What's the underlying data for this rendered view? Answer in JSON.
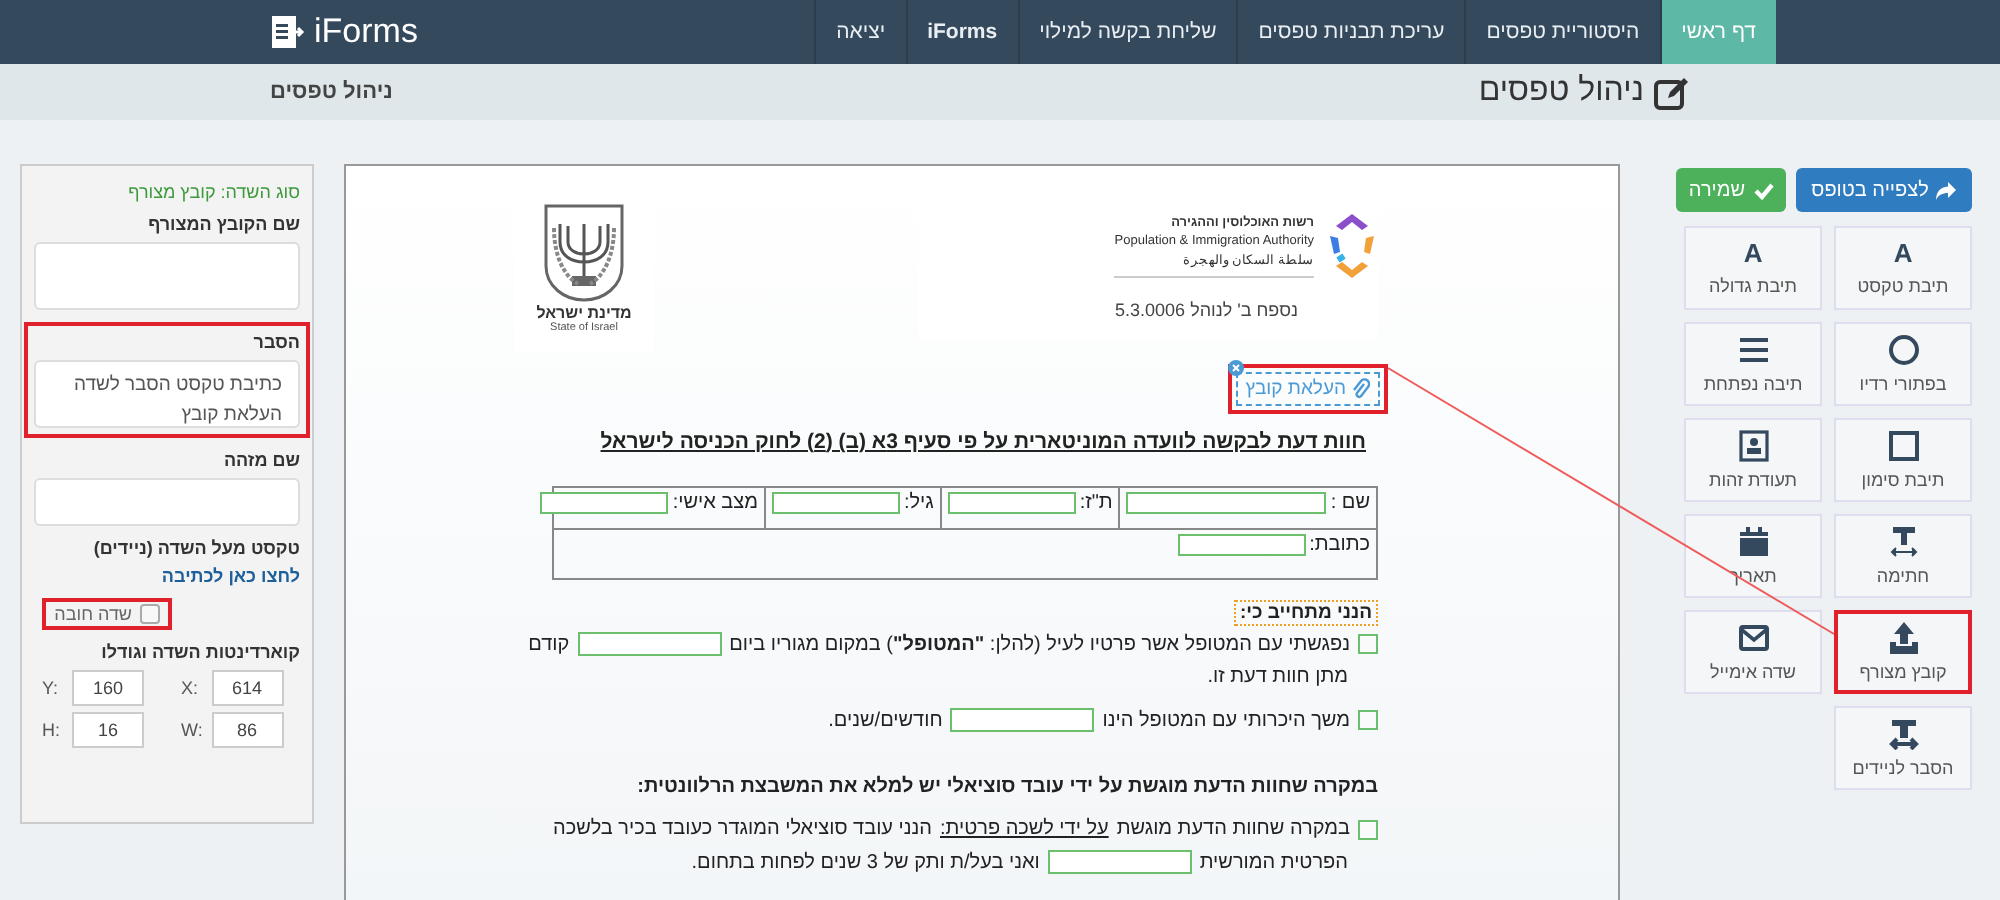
{
  "app": {
    "logo": "iForms"
  },
  "nav": [
    {
      "label": "דף ראשי",
      "selected": true,
      "bold": false
    },
    {
      "label": "היסטוריית טפסים",
      "selected": false,
      "bold": false
    },
    {
      "label": "עריכת תבניות טפסים",
      "selected": false,
      "bold": false
    },
    {
      "label": "שליחת בקשה למילוי",
      "selected": false,
      "bold": false
    },
    {
      "label": "iForms",
      "selected": false,
      "bold": true
    },
    {
      "label": "יציאה",
      "selected": false,
      "bold": false
    }
  ],
  "subheader": {
    "breadcrumb": "ניהול טפסים",
    "page_title": "ניהול טפסים"
  },
  "properties": {
    "field_type": "סוג השדה: קובץ מצורף",
    "sections": [
      {
        "kind": "textarea",
        "label": "שם הקובץ המצורף",
        "highlighted": false
      },
      {
        "kind": "textarea",
        "label": "הסבר",
        "value": "כתיבת טקסט הסבר לשדה העלאת קובץ",
        "highlighted": true
      },
      {
        "kind": "input",
        "label": "שם מזהה",
        "highlighted": false
      },
      {
        "kind": "link",
        "label": "טקסט מעל השדה (ניידים)",
        "link": "לחצו כאן לכתיבה",
        "highlighted": false
      },
      {
        "kind": "checkbox",
        "label": "שדה חובה",
        "checked": false,
        "highlighted": true
      },
      {
        "kind": "coords",
        "label": "קוארדינטות השדה וגודלו",
        "highlighted": false,
        "coords": [
          {
            "label": "X:",
            "value": "614"
          },
          {
            "label": "Y:",
            "value": "160"
          },
          {
            "label": "W:",
            "value": "86"
          },
          {
            "label": "H:",
            "value": "16"
          }
        ]
      }
    ]
  },
  "document": {
    "emblem": {
      "caption": "מדינת ישראל",
      "caption_en": "State of Israel"
    },
    "authority": {
      "name_he": "רשות האוכלוסין וההגירה",
      "name_en": "Population & Immigration Authority",
      "name_ar": "سلطة السكان والهجرة"
    },
    "appendix": "נספח ב' לנוהל 5.3.0006",
    "upload_field": {
      "label": "העלאת קובץ",
      "highlighted": true
    },
    "title": "חוות דעת לבקשה לוועדה המוניטארית על פי סעיף 3א (ב) (2) לחוק הכניסה לישראל",
    "table": [
      [
        {
          "label": "שם :"
        },
        {
          "label": "ת\"ז:"
        },
        {
          "label": "גיל:"
        },
        {
          "label": "מצב אישי:"
        }
      ],
      [
        {
          "label": "כתובת:"
        }
      ]
    ],
    "pledge": "הנני מתחייב כי:",
    "items": [
      {
        "kind": "checkbox",
        "checked": false,
        "lines": [
          [
            {
              "kind": "text",
              "text": "נפגשתי עם המטופל אשר פרטיו לעיל (להלן: **\"המטופל\"**) במקום מגוריו ביום"
            },
            {
              "kind": "field"
            },
            {
              "kind": "text",
              "text": "קודם"
            }
          ],
          [
            {
              "kind": "text",
              "text": "מתן חוות דעת זו."
            }
          ]
        ]
      },
      {
        "kind": "checkbox",
        "checked": false,
        "lines": [
          [
            {
              "kind": "text",
              "text": "משך היכרותי עם המטופל הינו"
            },
            {
              "kind": "field"
            },
            {
              "kind": "text",
              "text": "חודשים/שנים."
            }
          ]
        ]
      },
      {
        "kind": "heading",
        "text": "במקרה שחוות הדעת מוגשת על ידי עובד סוציאלי יש  למלא את המשבצת הרלוונטית:"
      },
      {
        "kind": "checkbox",
        "checked": false,
        "lines": [
          [
            {
              "kind": "text",
              "text": "במקרה שחוות הדעת מוגשת"
            },
            {
              "kind": "underlined",
              "text": "על ידי לשכה פרטית:"
            },
            {
              "kind": "text",
              "text": "הנני עובד סוציאלי המוגדר כעובד בכיר בלשכה"
            }
          ],
          [
            {
              "kind": "text",
              "text": "הפרטית המורשית"
            },
            {
              "kind": "field"
            },
            {
              "kind": "text",
              "text": "ואני בעל/ת ותק של 3 שנים לפחות בתחום."
            }
          ]
        ]
      }
    ]
  },
  "toolbar": {
    "buttons": [
      {
        "kind": "preview",
        "label": "לצפייה בטופס"
      },
      {
        "kind": "save",
        "label": "שמירה"
      }
    ],
    "tools": [
      {
        "kind": "letter",
        "glyph": "A",
        "label": "תיבת טקסט",
        "highlighted": false
      },
      {
        "kind": "letter",
        "glyph": "A",
        "label": "תיבת גדולה",
        "highlighted": false
      },
      {
        "kind": "radio",
        "label": "בפתורי רדיו",
        "highlighted": false
      },
      {
        "kind": "dropdown",
        "label": "תיבה נפתחת",
        "highlighted": false
      },
      {
        "kind": "checkbox",
        "label": "תיבת סימון",
        "highlighted": false
      },
      {
        "kind": "idcard",
        "label": "תעודת זהות",
        "highlighted": false
      },
      {
        "kind": "signature",
        "label": "חתימה",
        "highlighted": false
      },
      {
        "kind": "date",
        "label": "תאריך",
        "highlighted": false
      },
      {
        "kind": "attachment",
        "label": "קובץ מצורף",
        "highlighted": true
      },
      {
        "kind": "email",
        "label": "שדה אימייל",
        "highlighted": false
      },
      {
        "kind": "mobile",
        "label": "הסבר לניידים",
        "highlighted": false
      }
    ]
  }
}
